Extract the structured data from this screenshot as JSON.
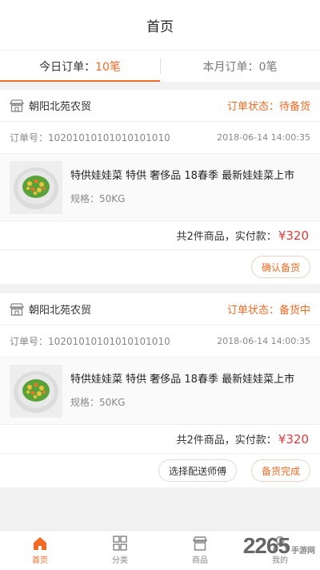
{
  "header": {
    "title": "首页"
  },
  "tabs": [
    {
      "label": "今日订单：",
      "count": "10笔"
    },
    {
      "label": "本月订单：",
      "count": "0笔"
    }
  ],
  "orders": [
    {
      "store": "朝阳北苑农贸",
      "status": "订单状态：待备货",
      "order_label": "订单号：",
      "order_no": "10201010101010101010",
      "time": "2018-06-14  14:00:35",
      "product_name": "特供娃娃菜 特供 奢侈品 18春季   最新娃娃菜上市",
      "spec": "规格：50KG",
      "total_label": "共2件商品，实付款：",
      "price": "¥320",
      "actions": [
        "确认备货"
      ]
    },
    {
      "store": "朝阳北苑农贸",
      "status": "订单状态：备货中",
      "order_label": "订单号：",
      "order_no": "10201010101010101010",
      "time": "2018-06-14  14:00:35",
      "product_name": "特供娃娃菜 特供 奢侈品 18春季   最新娃娃菜上市",
      "spec": "规格：50KG",
      "total_label": "共2件商品，实付款：",
      "price": "¥320",
      "actions": [
        "选择配送师傅",
        "备货完成"
      ]
    }
  ],
  "nav": [
    {
      "label": "首页",
      "icon": "home-icon"
    },
    {
      "label": "分类",
      "icon": "grid-icon"
    },
    {
      "label": "商品",
      "icon": "store-icon"
    },
    {
      "label": "我的",
      "icon": "user-icon"
    }
  ],
  "watermark": {
    "big": "2265",
    "small": "手游网"
  },
  "colors": {
    "accent": "#f26b25",
    "price": "#e23b3b"
  }
}
